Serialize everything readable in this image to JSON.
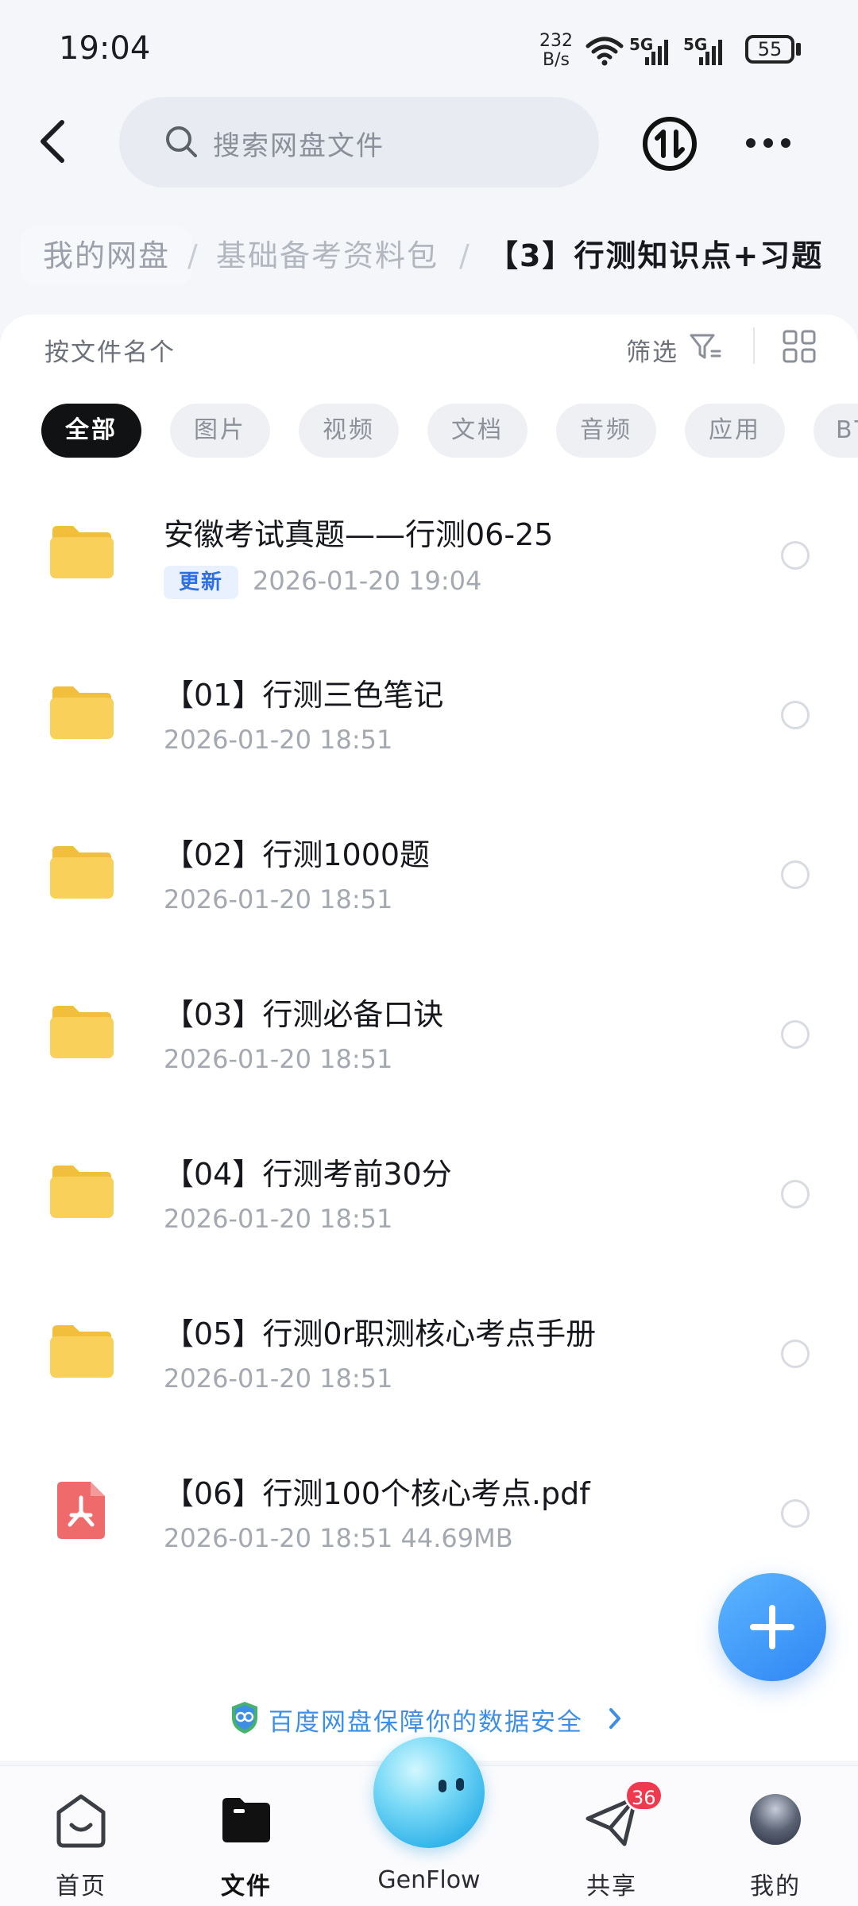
{
  "status_bar": {
    "time": "19:04",
    "net_speed_value": "232",
    "net_speed_unit": "B/s",
    "signal1_label": "5G",
    "signal2_label": "5G",
    "battery": "55"
  },
  "top_bar": {
    "search_placeholder": "搜索网盘文件"
  },
  "breadcrumb": {
    "items": [
      "我的网盘",
      "基础备考资料包",
      "【3】行测知识点+习题"
    ],
    "separator": "/"
  },
  "toolbar": {
    "sort_label": "按文件名个",
    "filter_label": "筛选"
  },
  "filter_chips": {
    "items": [
      "全部",
      "图片",
      "视频",
      "文档",
      "音频",
      "应用",
      "BT"
    ],
    "active": "全部"
  },
  "files": [
    {
      "name": "安徽考试真题——行测06-25",
      "badge": "更新",
      "meta": "2026-01-20   19:04",
      "type": "folder"
    },
    {
      "name": "【01】行测三色笔记",
      "meta": "2026-01-20   18:51",
      "type": "folder"
    },
    {
      "name": "【02】行测1000题",
      "meta": "2026-01-20   18:51",
      "type": "folder"
    },
    {
      "name": "【03】行测必备口诀",
      "meta": "2026-01-20   18:51",
      "type": "folder"
    },
    {
      "name": "【04】行测考前30分",
      "meta": "2026-01-20   18:51",
      "type": "folder"
    },
    {
      "name": "【05】行测0r职测核心考点手册",
      "meta": "2026-01-20   18:51",
      "type": "folder"
    },
    {
      "name": "【06】行测100个核心考点.pdf",
      "meta": "2026-01-20   18:51   44.69MB",
      "type": "pdf"
    }
  ],
  "security_notice": "百度网盘保障你的数据安全",
  "bottom_nav": {
    "home": "首页",
    "files": "文件",
    "genflow": "GenFlow",
    "share": "共享",
    "share_badge": "36",
    "me": "我的"
  },
  "colors": {
    "accent": "#2f86f4",
    "folder": "#f8d05a",
    "pdf": "#ef6b6b",
    "badge_red": "#f0384e"
  }
}
